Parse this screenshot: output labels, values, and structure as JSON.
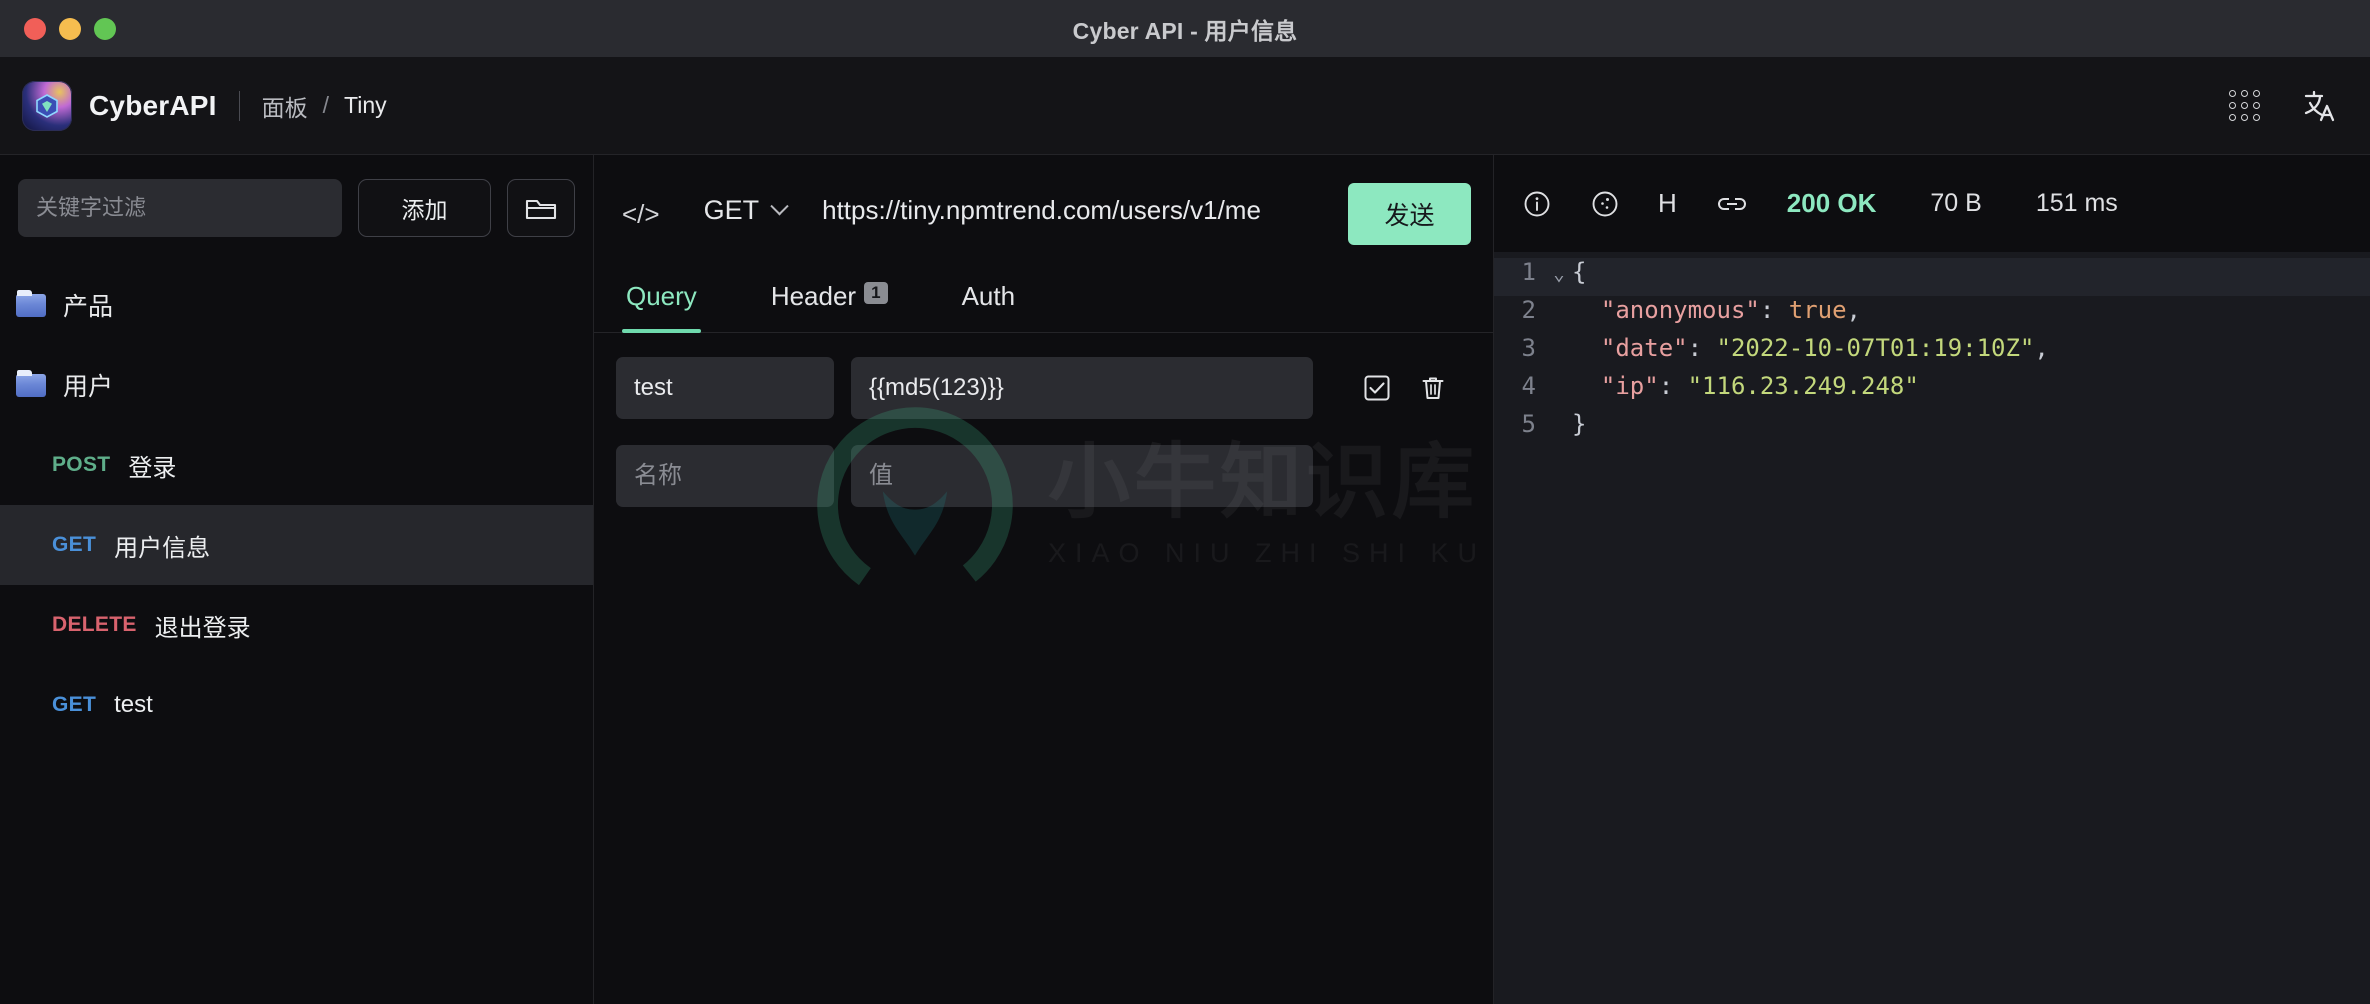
{
  "window": {
    "title": "Cyber API - 用户信息"
  },
  "header": {
    "brand": "CyberAPI",
    "breadcrumb_root": "面板",
    "breadcrumb_sep": "/",
    "breadcrumb_current": "Tiny",
    "apps_icon": "grid-apps-icon",
    "language_icon": "translate-icon"
  },
  "sidebar": {
    "filter_placeholder": "关键字过滤",
    "filter_value": "",
    "add_label": "添加",
    "folder_button_icon": "folder-icon",
    "tree": [
      {
        "type": "folder",
        "label": "产品"
      },
      {
        "type": "folder",
        "label": "用户"
      },
      {
        "type": "api",
        "method": "POST",
        "name": "登录",
        "active": false
      },
      {
        "type": "api",
        "method": "GET",
        "name": "用户信息",
        "active": true
      },
      {
        "type": "api",
        "method": "DELETE",
        "name": "退出登录",
        "active": false
      },
      {
        "type": "api",
        "method": "GET",
        "name": "test",
        "active": false
      }
    ],
    "method_colors": {
      "POST": "#5fae8a",
      "GET": "#4a90d9",
      "DELETE": "#d8636e"
    }
  },
  "request": {
    "code_icon": "code-brackets-icon",
    "method": "GET",
    "url": "https://tiny.npmtrend.com/users/v1/me",
    "send_label": "发送",
    "tabs": [
      {
        "label": "Query",
        "badge": "",
        "active": true
      },
      {
        "label": "Header",
        "badge": "1",
        "active": false
      },
      {
        "label": "Auth",
        "badge": "",
        "active": false
      }
    ],
    "params": [
      {
        "key": "test",
        "value": "{{md5(123)}}",
        "enabled": true,
        "placeholder_key": "名称",
        "placeholder_value": "值"
      },
      {
        "key": "",
        "value": "",
        "enabled": false,
        "placeholder_key": "名称",
        "placeholder_value": "值"
      }
    ],
    "row_actions": {
      "check_icon": "checkbox-checked-icon",
      "delete_icon": "trash-icon"
    }
  },
  "response": {
    "icons": [
      "info-circle-icon",
      "cookie-icon",
      "headers-h-icon",
      "link-icon"
    ],
    "headers_label": "H",
    "status": "200 OK",
    "status_color": "#8de8c0",
    "size": "70 B",
    "time": "151 ms",
    "body_lines": [
      {
        "no": "1",
        "fold": "⌄",
        "segments": [
          {
            "t": "{",
            "c": "j-pun"
          }
        ]
      },
      {
        "no": "2",
        "fold": "",
        "segments": [
          {
            "t": "  \"anonymous\"",
            "c": "j-key"
          },
          {
            "t": ": ",
            "c": "j-pun"
          },
          {
            "t": "true",
            "c": "j-bool"
          },
          {
            "t": ",",
            "c": "j-pun"
          }
        ]
      },
      {
        "no": "3",
        "fold": "",
        "segments": [
          {
            "t": "  \"date\"",
            "c": "j-key"
          },
          {
            "t": ": ",
            "c": "j-pun"
          },
          {
            "t": "\"2022-10-07T01:19:10Z\"",
            "c": "j-str"
          },
          {
            "t": ",",
            "c": "j-pun"
          }
        ]
      },
      {
        "no": "4",
        "fold": "",
        "segments": [
          {
            "t": "  \"ip\"",
            "c": "j-key"
          },
          {
            "t": ": ",
            "c": "j-pun"
          },
          {
            "t": "\"116.23.249.248\"",
            "c": "j-str"
          }
        ]
      },
      {
        "no": "5",
        "fold": "",
        "segments": [
          {
            "t": "}",
            "c": "j-pun"
          }
        ]
      }
    ]
  },
  "watermark": {
    "main": "小牛知识库",
    "sub": "XIAO NIU ZHI SHI KU"
  }
}
